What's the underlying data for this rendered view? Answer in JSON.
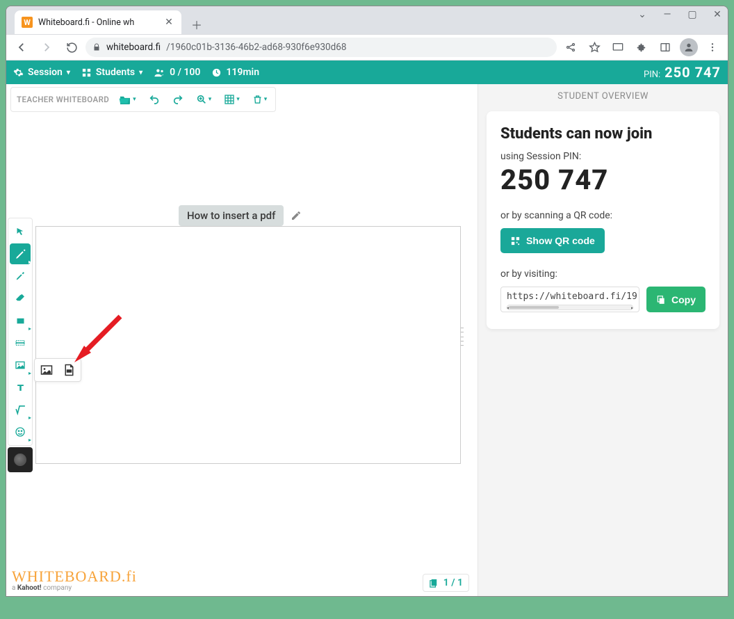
{
  "browser": {
    "tab_title": "Whiteboard.fi - Online wh",
    "favicon_letter": "W",
    "url_host": "whiteboard.fi",
    "url_path": "/1960c01b-3136-46b2-ad68-930f6e930d68"
  },
  "topnav": {
    "session_label": "Session",
    "students_label": "Students",
    "student_count": "0 / 100",
    "time_label": "119min",
    "pin_prefix": "PIN:",
    "pin_value": "250 747"
  },
  "whiteboard_strip": {
    "label": "TEACHER WHITEBOARD"
  },
  "canvas": {
    "title_chip": "How to insert a pdf"
  },
  "right_panel": {
    "overview_label": "STUDENT OVERVIEW",
    "heading": "Students can now join",
    "using_pin_label": "using Session PIN:",
    "pin": "250 747",
    "qr_label": "or by scanning a QR code:",
    "qr_button": "Show QR code",
    "visit_label": "or by visiting:",
    "join_url": "https://whiteboard.fi/19",
    "copy_button": "Copy"
  },
  "page_indicator": {
    "text": "1 / 1"
  },
  "watermark": {
    "line1": "WHITEBOARD.fi",
    "line2_a": "a ",
    "line2_b": "Kahoot!",
    "line2_c": " company"
  },
  "tools": {
    "select": "select",
    "pen": "pen",
    "highlighter": "highlighter",
    "eraser": "eraser",
    "shape": "shape",
    "line": "line",
    "image": "image",
    "text": "text",
    "math": "math",
    "emoji": "emoji"
  }
}
